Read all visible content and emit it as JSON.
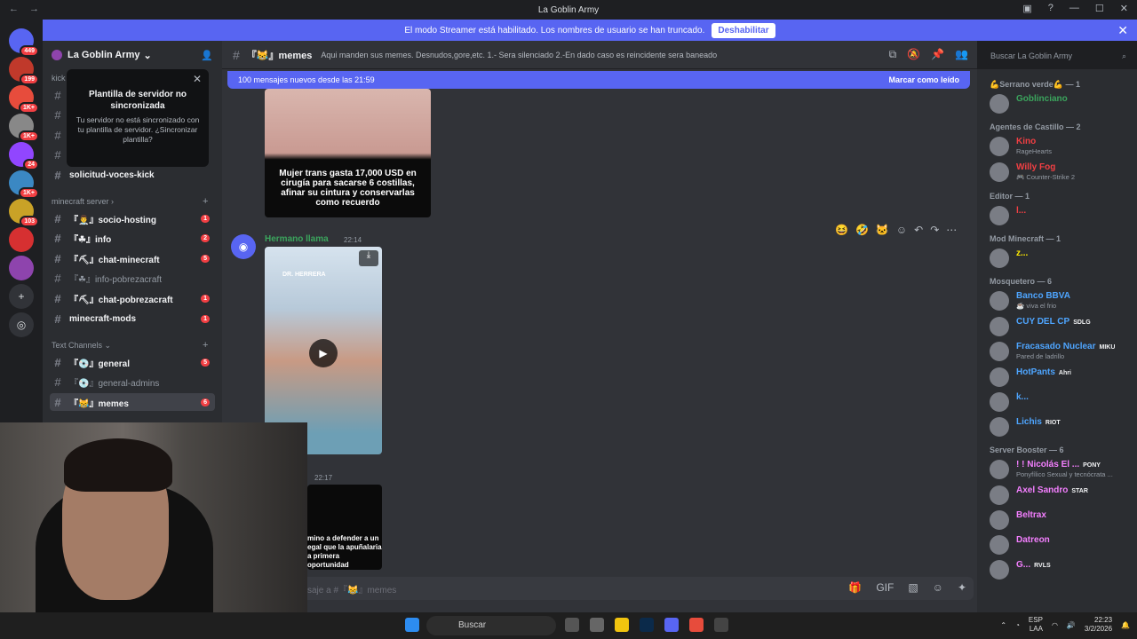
{
  "window": {
    "title": "La Goblin Army"
  },
  "banner": {
    "text": "El modo Streamer está habilitado. Los nombres de usuario se han truncado.",
    "button": "Deshabilitar"
  },
  "guilds": [
    {
      "badge": "449",
      "color": "#5865f2"
    },
    {
      "badge": "199",
      "color": "#c0392b"
    },
    {
      "badge": "1K+",
      "color": "#e74c3c"
    },
    {
      "badge": "1K+",
      "color": "#888888"
    },
    {
      "badge": "24",
      "color": "#9146ff"
    },
    {
      "badge": "1K+",
      "color": "#3b88c3"
    },
    {
      "badge": "103",
      "color": "#c9a227"
    },
    {
      "badge": "",
      "color": "#d63031"
    },
    {
      "badge": "",
      "color": "#8e44ad"
    }
  ],
  "server": {
    "name": "La Goblin Army"
  },
  "popup": {
    "title": "Plantilla de servidor no sincronizada",
    "body": "Tu servidor no está sincronizado con tu plantilla de servidor. ¿Sincronizar plantilla?"
  },
  "channels_top": {
    "category_fragment": "kick",
    "voces": "solicitud-voces-kick"
  },
  "categories": {
    "minecraft": "minecraft server",
    "text": "Text Channels"
  },
  "minecraft_channels": [
    {
      "name": "『👨‍⚕️』socio-hosting",
      "badge": "1"
    },
    {
      "name": "『☘』info",
      "badge": "2"
    },
    {
      "name": "『⛏』chat-minecraft",
      "badge": "5"
    },
    {
      "name": "『☘』info-pobrezacraft",
      "badge": ""
    },
    {
      "name": "『⛏』chat-pobrezacraft",
      "badge": "1"
    },
    {
      "name": "minecraft-mods",
      "badge": "1"
    }
  ],
  "text_channels": [
    {
      "name": "『💿』general",
      "badge": "5"
    },
    {
      "name": "『💿』general-admins",
      "badge": ""
    },
    {
      "name": "『😹』memes",
      "badge": "6"
    }
  ],
  "chat_header": {
    "channel": "『😹』memes",
    "topic": "Aqui manden sus memes. Desnudos,gore,etc. 1.- Sera silenciado 2.-En dado caso es reincidente sera baneado"
  },
  "search": {
    "placeholder": "Buscar La Goblin Army"
  },
  "new_messages": {
    "text": "100 mensajes nuevos desde las 21:59",
    "mark": "Marcar como leído"
  },
  "image_caption": "Mujer trans gasta 17,000 USD en cirugía para sacarse 6 costillas, afinar su cintura y conservarlas como recuerdo",
  "message": {
    "author": "Hermano llama",
    "time": "22:14",
    "video_label": "DR. HERRERA"
  },
  "message2": {
    "time": "22:17",
    "caption": "mino a defender a un egal que la apuñalaria a primera oportunidad"
  },
  "composer": {
    "placeholder": "saje a #『😹』memes"
  },
  "members": {
    "groups": [
      {
        "title": "💪Serrano verde💪 — 1",
        "items": [
          {
            "name": "Goblinciano",
            "color": "#3ba55d",
            "sub": "",
            "tag": ""
          }
        ]
      },
      {
        "title": "Agentes de Castillo — 2",
        "items": [
          {
            "name": "Kino",
            "color": "#f23f43",
            "sub": "RageHearts",
            "tag": ""
          },
          {
            "name": "Willy Fog",
            "color": "#f23f43",
            "sub": "🎮 Counter-Strike 2",
            "tag": ""
          }
        ]
      },
      {
        "title": "Editor — 1",
        "items": [
          {
            "name": "l...",
            "color": "#f23f43",
            "sub": "",
            "tag": ""
          }
        ]
      },
      {
        "title": "Mod Minecraft — 1",
        "items": [
          {
            "name": "z...",
            "color": "#ffea00",
            "sub": "",
            "tag": ""
          }
        ]
      },
      {
        "title": "Mosquetero — 6",
        "items": [
          {
            "name": "Banco BBVA",
            "color": "#4ea5ff",
            "sub": "☕ viva el frio",
            "tag": ""
          },
          {
            "name": "CUY DEL CP",
            "color": "#4ea5ff",
            "sub": "",
            "tag": "SDLG"
          },
          {
            "name": "Fracasado Nuclear",
            "color": "#4ea5ff",
            "sub": "Pared de ladrillo",
            "tag": "MIKU"
          },
          {
            "name": "HotPants",
            "color": "#4ea5ff",
            "sub": "",
            "tag": "Ahri"
          },
          {
            "name": "k...",
            "color": "#4ea5ff",
            "sub": "",
            "tag": ""
          },
          {
            "name": "Lichis",
            "color": "#4ea5ff",
            "sub": "",
            "tag": "RIOT"
          }
        ]
      },
      {
        "title": "Server Booster — 6",
        "items": [
          {
            "name": "! ! Nicolás El ...",
            "color": "#f47fff",
            "sub": "Ponyfílico Sexual y tecnócrata ...",
            "tag": "PONY"
          },
          {
            "name": "Axel Sandro",
            "color": "#f47fff",
            "sub": "",
            "tag": "STAR"
          },
          {
            "name": "Beltrax",
            "color": "#f47fff",
            "sub": "",
            "tag": ""
          },
          {
            "name": "Datreon",
            "color": "#f47fff",
            "sub": "",
            "tag": ""
          },
          {
            "name": "G...",
            "color": "#f47fff",
            "sub": "",
            "tag": "RVLS"
          }
        ]
      }
    ]
  },
  "taskbar": {
    "search": "Buscar",
    "lang": "ESP",
    "lang2": "LAA",
    "time": "22:23",
    "date": "3/2/2026"
  }
}
